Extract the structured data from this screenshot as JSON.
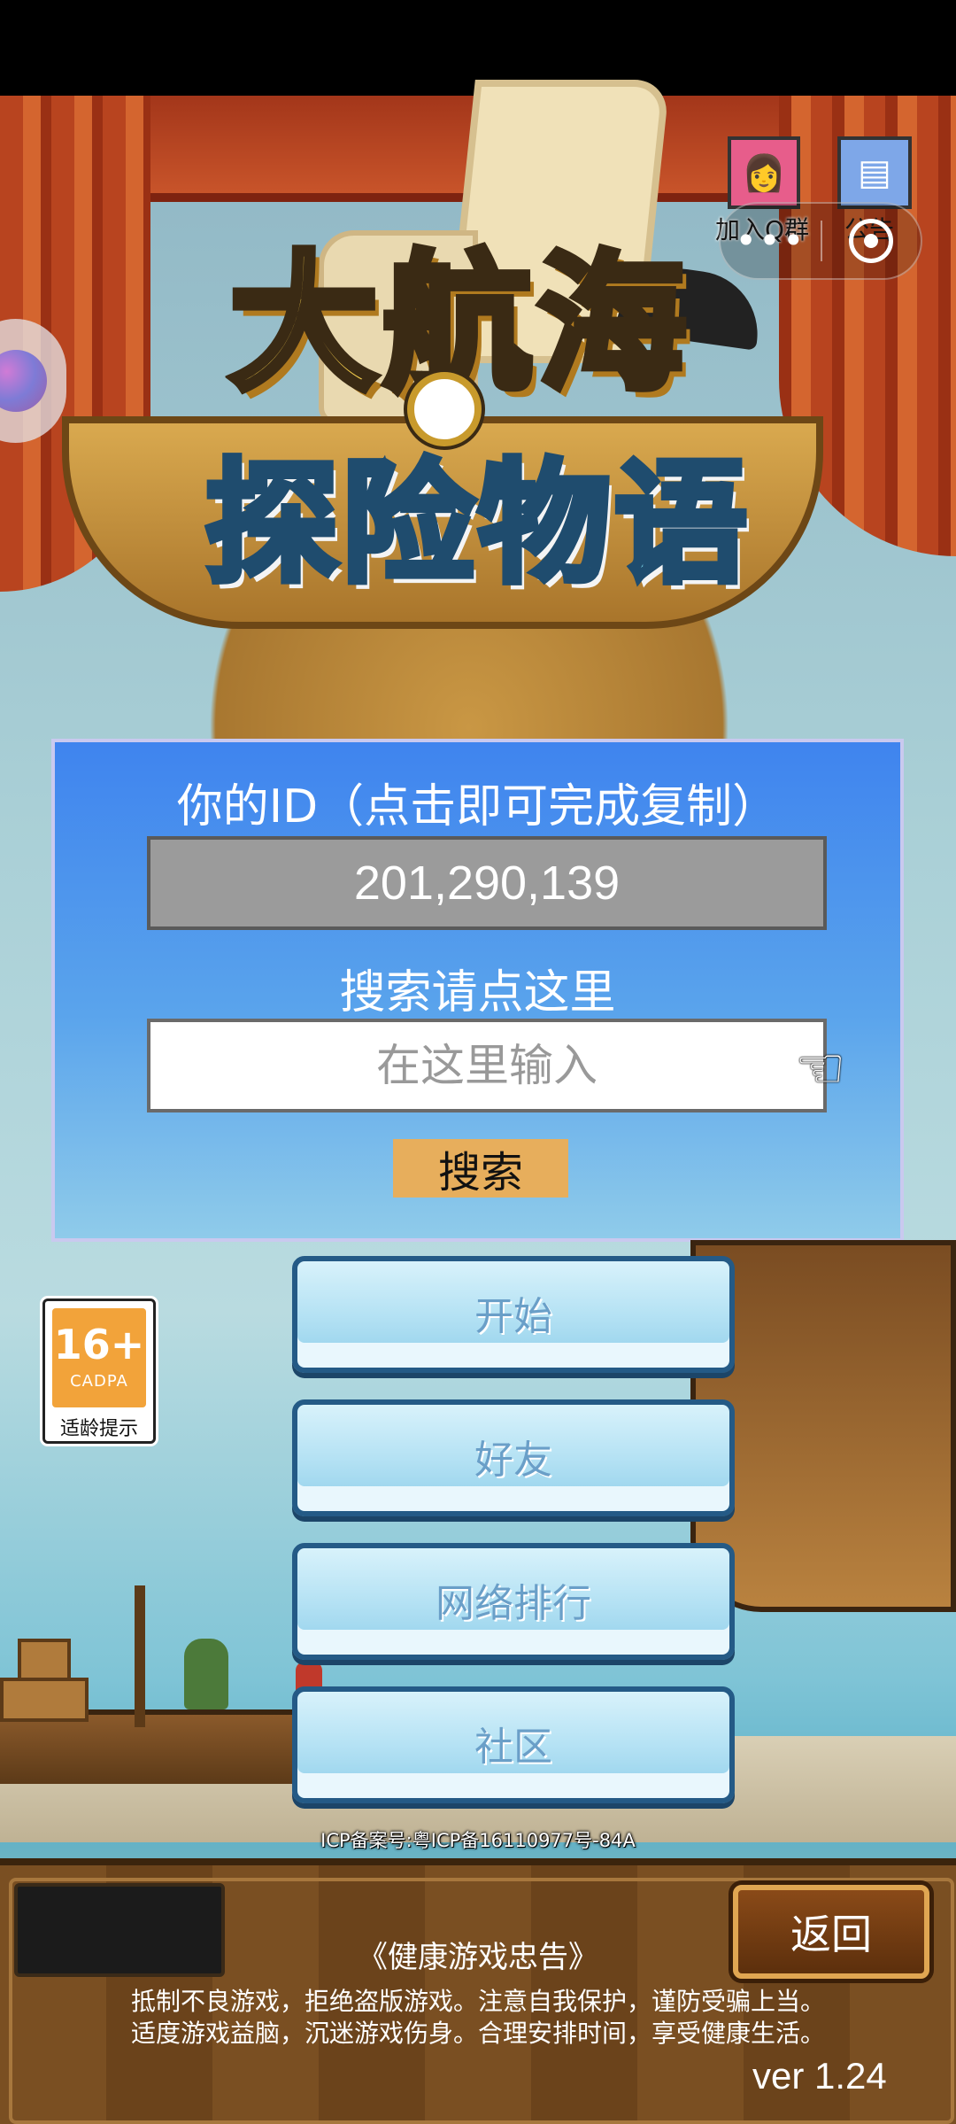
{
  "logo": {
    "line1": "大航海",
    "line2": "探险物语"
  },
  "top_icons": {
    "qq_group_label": "加入Q群",
    "notice_label": "公告",
    "capsule_more": "•••"
  },
  "panel": {
    "id_title": "你的ID（点击即可完成复制）",
    "id_value": "201,290,139",
    "search_title": "搜索请点这里",
    "search_placeholder": "在这里输入",
    "search_button": "搜索"
  },
  "menu": {
    "start": "开始",
    "friends": "好友",
    "ranking": "网络排行",
    "community": "社区"
  },
  "age_rating": {
    "age": "16+",
    "org": "CADPA",
    "tip": "适龄提示"
  },
  "icp": "ICP备案号:粤ICP备16110977号-84A",
  "footer": {
    "back_button": "返回",
    "health_title": "《健康游戏忠告》",
    "health_line1": "抵制不良游戏，拒绝盗版游戏。注意自我保护，谨防受骗上当。",
    "health_line2": "适度游戏益脑，沉迷游戏伤身。合理安排时间，享受健康生活。",
    "version": "ver 1.24"
  },
  "colors": {
    "panel_top": "#3f84ee",
    "panel_bottom": "#8fcbea",
    "search_button": "#e7ae5c",
    "menu_border": "#245a86"
  }
}
